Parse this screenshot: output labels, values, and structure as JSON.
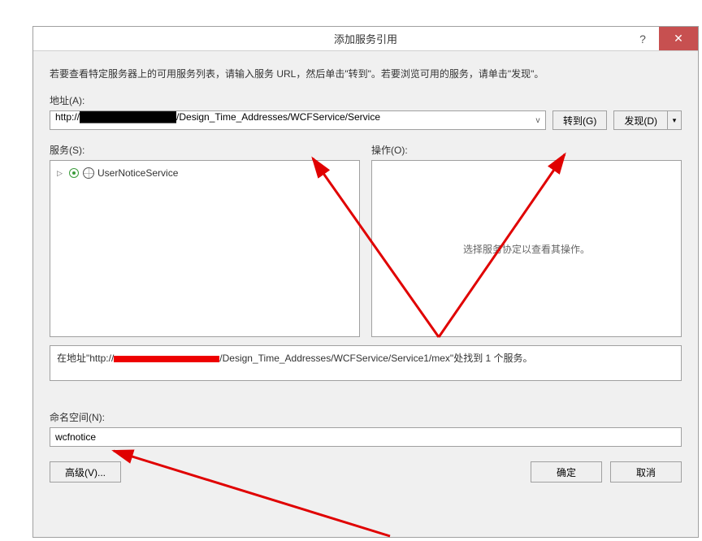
{
  "titlebar": {
    "title": "添加服务引用",
    "help_label": "?",
    "close_label": "✕"
  },
  "intro": "若要查看特定服务器上的可用服务列表，请输入服务 URL，然后单击\"转到\"。若要浏览可用的服务，请单击\"发现\"。",
  "address": {
    "label": "地址(A):",
    "value": "http://██████████████/Design_Time_Addresses/WCFService/Service",
    "dropdown_glyph": "v"
  },
  "buttons": {
    "go": "转到(G)",
    "discover": "发现(D)",
    "discover_dd": "▾",
    "advanced": "高级(V)...",
    "ok": "确定",
    "cancel": "取消"
  },
  "panels": {
    "services_label": "服务(S):",
    "operations_label": "操作(O):",
    "operations_placeholder": "选择服务协定以查看其操作。",
    "tree": {
      "expand_glyph": "▷",
      "item_label": "UserNoticeService"
    }
  },
  "status": {
    "prefix": "在地址\"http://",
    "suffix": "/Design_Time_Addresses/WCFService/Service1/mex\"处找到 1 个服务。"
  },
  "namespace": {
    "label": "命名空间(N):",
    "value": "wcfnotice"
  }
}
